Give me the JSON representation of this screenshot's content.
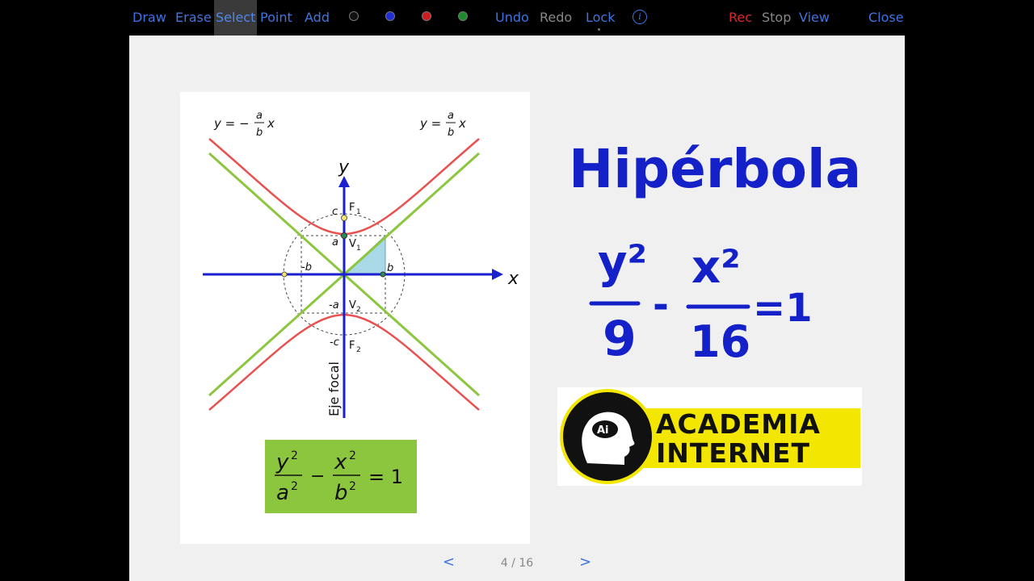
{
  "toolbar": {
    "draw": "Draw",
    "erase": "Erase",
    "select": "Select",
    "point": "Point",
    "add": "Add",
    "colors": [
      {
        "name": "black",
        "hex": "#111111",
        "outline": "#777777"
      },
      {
        "name": "blue",
        "hex": "#1e2fd6"
      },
      {
        "name": "red",
        "hex": "#d11c1c"
      },
      {
        "name": "green",
        "hex": "#1f8a2c"
      }
    ],
    "undo": "Undo",
    "redo": "Redo",
    "lock": "Lock",
    "info_icon": "info-icon",
    "rec": "Rec",
    "stop": "Stop",
    "view": "View",
    "close": "Close"
  },
  "figure": {
    "asymptote_left": {
      "lhs": "y = −",
      "num": "a",
      "den": "b",
      "var": "x"
    },
    "asymptote_right": {
      "lhs": "y =",
      "num": "a",
      "den": "b",
      "var": "x"
    },
    "axis_y": "y",
    "axis_x": "x",
    "label_c": "c",
    "label_F1": "F",
    "label_F1_sub": "1",
    "label_a": "a",
    "label_V1": "V",
    "label_V1_sub": "1",
    "label_neg_b": "-b",
    "label_b": "b",
    "label_neg_a": "-a",
    "label_V2": "V",
    "label_V2_sub": "2",
    "label_neg_c": "-c",
    "label_F2": "F",
    "label_F2_sub": "2",
    "focal_axis": "Eje focal",
    "formula": {
      "num1": "y",
      "den1": "a",
      "minus": "−",
      "num2": "x",
      "den2": "b",
      "exp": "2",
      "equals": "= 1"
    },
    "colors": {
      "hyperbola": "#e8514f",
      "asymptote": "#8cc63f",
      "axis": "#1a1fd0",
      "box": "#8cc63f"
    }
  },
  "handwriting": {
    "title": "Hipérbola",
    "numerator_1": "y²",
    "denominator_1": "9",
    "minus": "-",
    "numerator_2": "x²",
    "denominator_2": "16",
    "equals": "=1",
    "ink_color": "#1420c8"
  },
  "logo": {
    "badge": "Ai",
    "line1": "ACADEMIA",
    "line2": "INTERNET"
  },
  "pager": {
    "prev": "<",
    "indicator": "4 / 16",
    "next": ">"
  }
}
